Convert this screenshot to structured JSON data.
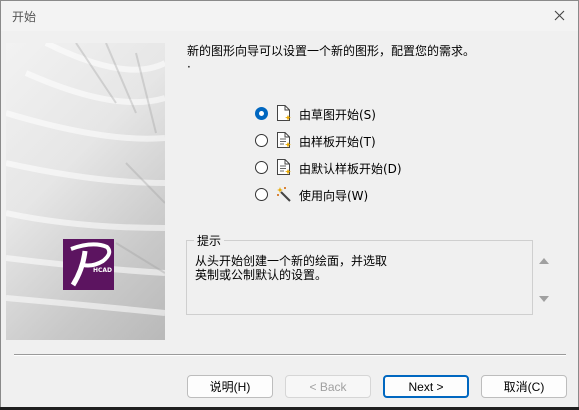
{
  "window": {
    "title": "开始"
  },
  "header": {
    "line1": "新的图形向导可以设置一个新的图形，配置您的需求。",
    "line2": "·"
  },
  "logo": {
    "text": "HCAD"
  },
  "options": [
    {
      "label": "由草图开始(S)",
      "checked": true,
      "icon": "blank-document-icon"
    },
    {
      "label": "由样板开始(T)",
      "checked": false,
      "icon": "template-document-icon"
    },
    {
      "label": "由默认样板开始(D)",
      "checked": false,
      "icon": "default-template-icon"
    },
    {
      "label": "使用向导(W)",
      "checked": false,
      "icon": "wizard-wand-icon"
    }
  ],
  "hint": {
    "legend": "提示",
    "line1": "从头开始创建一个新的绘面，并选取",
    "line2": "英制或公制默认的设置。"
  },
  "buttons": {
    "help": "说明(H)",
    "back": "< Back",
    "next": "Next >",
    "cancel": "取消(C)"
  }
}
